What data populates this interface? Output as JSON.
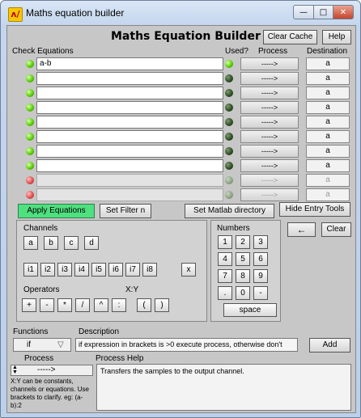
{
  "window": {
    "title": "Maths equation builder",
    "min_glyph": "—",
    "max_glyph": "□",
    "close_glyph": "✕",
    "icon_glyph": "ʌ/"
  },
  "header": {
    "title": "Maths Equation Builder",
    "clear_cache": "Clear Cache",
    "help": "Help"
  },
  "columns": {
    "check_equations": "Check  Equations",
    "used": "Used?",
    "process": "Process",
    "destination": "Destination"
  },
  "rows": [
    {
      "check": "green",
      "equation": "a-b",
      "used": "on",
      "process": "----->",
      "destination": "a",
      "enabled": true
    },
    {
      "check": "green",
      "equation": "",
      "used": "dark",
      "process": "----->",
      "destination": "a",
      "enabled": true
    },
    {
      "check": "green",
      "equation": "",
      "used": "dark",
      "process": "----->",
      "destination": "a",
      "enabled": true
    },
    {
      "check": "green",
      "equation": "",
      "used": "dark",
      "process": "----->",
      "destination": "a",
      "enabled": true
    },
    {
      "check": "green",
      "equation": "",
      "used": "dark",
      "process": "----->",
      "destination": "a",
      "enabled": true
    },
    {
      "check": "green",
      "equation": "",
      "used": "dark",
      "process": "----->",
      "destination": "a",
      "enabled": true
    },
    {
      "check": "green",
      "equation": "",
      "used": "dark",
      "process": "----->",
      "destination": "a",
      "enabled": true
    },
    {
      "check": "green",
      "equation": "",
      "used": "dark",
      "process": "----->",
      "destination": "a",
      "enabled": true
    },
    {
      "check": "red",
      "equation": "",
      "used": "dim",
      "process": "----->",
      "destination": "a",
      "enabled": false
    },
    {
      "check": "red",
      "equation": "",
      "used": "dim",
      "process": "----->",
      "destination": "a",
      "enabled": false
    }
  ],
  "toolbar": {
    "apply": "Apply Equations",
    "set_filter": "Set Filter n",
    "set_matlab": "Set Matlab directory",
    "hide_entry": "Hide Entry Tools"
  },
  "channels": {
    "label": "Channels",
    "letters": [
      "a",
      "b",
      "c",
      "d"
    ],
    "inputs": [
      "i1",
      "i2",
      "i3",
      "i4",
      "i5",
      "i6",
      "i7",
      "i8"
    ],
    "multiply": "x"
  },
  "operators": {
    "label": "Operators",
    "xy_label": "X:Y",
    "keys": [
      "+",
      "-",
      "*",
      "/",
      "^",
      ":",
      "(",
      ")"
    ]
  },
  "numbers": {
    "label": "Numbers",
    "keys": [
      "1",
      "2",
      "3",
      "4",
      "5",
      "6",
      "7",
      "8",
      "9",
      ".",
      "0",
      "-"
    ],
    "space": "space"
  },
  "backspace_glyph": "←",
  "clear": "Clear",
  "functions": {
    "label": "Functions",
    "selected": "if",
    "arrow": "▽"
  },
  "description": {
    "label": "Description",
    "text": "if expression in brackets is >0 execute process, otherwise don't"
  },
  "add": "Add",
  "process": {
    "label": "Process",
    "selected": "----->",
    "note": "X:Y can be constants, channels or equations. Use brackets to clarify. eg: (a-b):2"
  },
  "process_help": {
    "label": "Process Help",
    "text": "Transfers the samples to the output channel."
  },
  "colors": {
    "apply_green": "#4fe07f",
    "led_green": "#58d000",
    "led_red": "#e05050"
  }
}
